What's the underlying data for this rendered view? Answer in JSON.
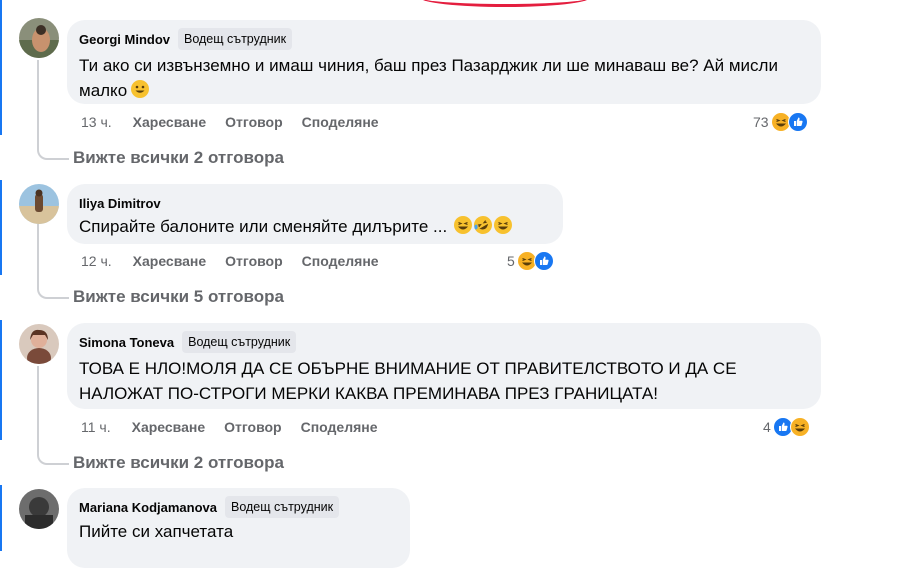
{
  "comments": [
    {
      "author": "Georgi Mindov",
      "badge": "Водещ сътрудник",
      "text": "Ти ако си извънземно и имаш чиния, баш през Пазарджик ли ше минаваш ве? Ай мисли малко",
      "inline_emoji": [
        "smile-emoji"
      ],
      "time": "13 ч.",
      "reaction_count": "73",
      "reactions": [
        "haha-reaction",
        "like-reaction"
      ],
      "view_replies": "Вижте всички 2 отговора"
    },
    {
      "author": "Iliya Dimitrov",
      "badge": "",
      "text": "Спирайте балоните или сменяйте дилърите ...",
      "inline_emoji": [
        "grin-emoji",
        "rofl-emoji",
        "grin-emoji"
      ],
      "time": "12 ч.",
      "reaction_count": "5",
      "reactions": [
        "haha-reaction",
        "like-reaction"
      ],
      "view_replies": "Вижте всички 5 отговора"
    },
    {
      "author": "Simona Toneva",
      "badge": "Водещ сътрудник",
      "text": "ТОВА Е НЛО!МОЛЯ ДА СЕ ОБЪРНЕ ВНИМАНИЕ ОТ ПРАВИТЕЛСТВОТО И ДА СЕ НАЛОЖАТ ПО-СТРОГИ МЕРКИ КАКВА ПРЕМИНАВА ПРЕЗ ГРАНИЦАТА!",
      "inline_emoji": [],
      "time": "11 ч.",
      "reaction_count": "4",
      "reactions": [
        "like-reaction",
        "haha-reaction"
      ],
      "view_replies": "Вижте всички 2 отговора"
    },
    {
      "author": "Mariana Kodjamanova",
      "badge": "Водещ сътрудник",
      "text": "Пийте си хапчетата"
    }
  ],
  "actions": {
    "like": "Харесване",
    "reply": "Отговор",
    "share": "Споделяне"
  },
  "colors": {
    "bubble": "#f0f2f5",
    "secondary_text": "#65676b",
    "like_blue": "#1877f2",
    "haha_yellow": "#f7b125"
  }
}
